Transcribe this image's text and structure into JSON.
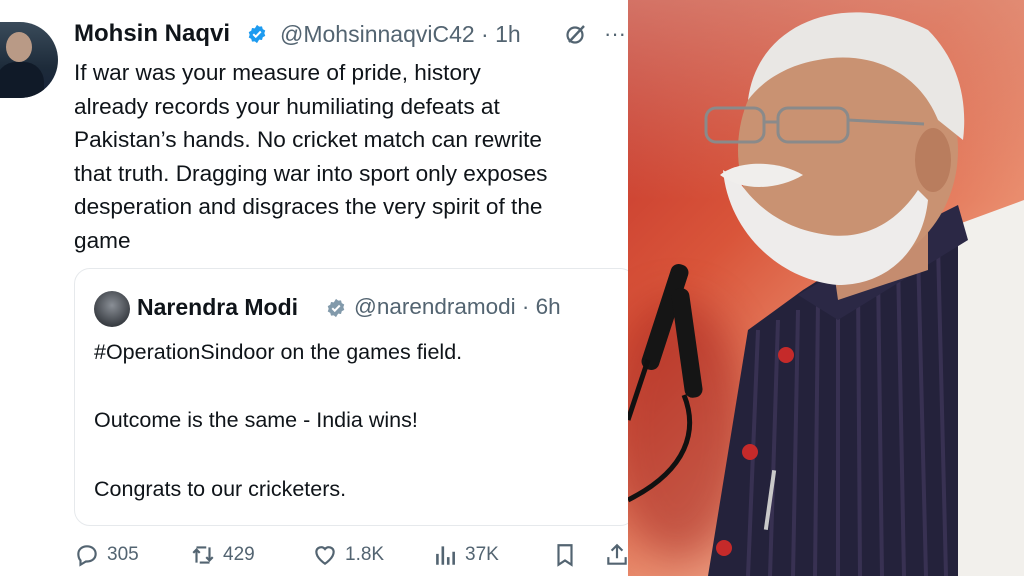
{
  "tweet": {
    "author_name": "Mohsin Naqvi",
    "handle_time": "@MohsinnaqviC42 · 1h",
    "lines": [
      "If war was your measure of pride, history",
      "already records your humiliating defeats at",
      "Pakistan’s hands. No cricket match can rewrite",
      "that truth. Dragging war into sport only exposes",
      "desperation and disgraces the very spirit of the",
      "game"
    ],
    "more": "···"
  },
  "quote": {
    "author_name": "Narendra Modi",
    "handle_time": "@narendramodi · 6h",
    "lines": [
      "#OperationSindoor on the games field.",
      "Outcome is the same - India wins!",
      "Congrats to our cricketers."
    ]
  },
  "actions": {
    "replies": "305",
    "reposts": "429",
    "likes": "1.8K",
    "views": "37K"
  },
  "colors": {
    "text": "#0f1419",
    "muted": "#536471",
    "verified": "#1d9bf0",
    "verified_gray": "#829aab"
  },
  "icons": [
    "verified-badge-icon",
    "grok-icon",
    "more-icon",
    "reply-icon",
    "repost-icon",
    "like-icon",
    "views-icon",
    "bookmark-icon",
    "share-icon"
  ]
}
